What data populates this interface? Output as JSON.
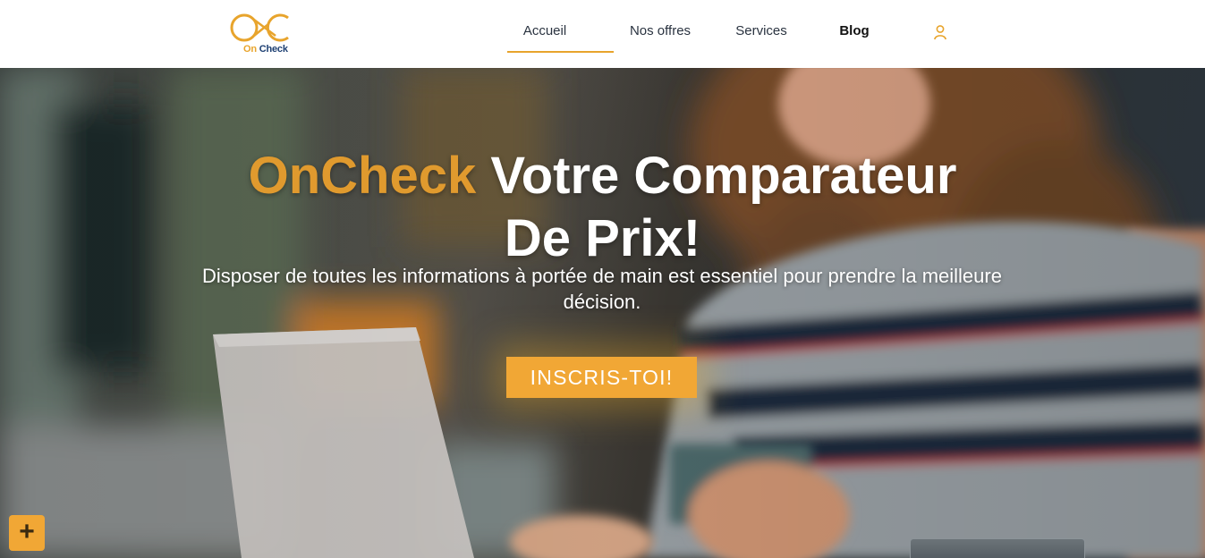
{
  "brand": {
    "logo_on": "On",
    "logo_check": "Check",
    "colors": {
      "accent": "#e8a42c",
      "dark_blue": "#1d3f72"
    }
  },
  "nav": {
    "items": [
      {
        "label": "Accueil",
        "active": true
      },
      {
        "label": "Nos offres",
        "active": false
      },
      {
        "label": "Services",
        "active": false
      },
      {
        "label": "Blog",
        "active": false
      }
    ],
    "user_icon": "user-icon"
  },
  "hero": {
    "title_brand": "OnCheck",
    "title_line1": " Votre Comparateur",
    "title_line2": "De Prix!",
    "subtitle": "Disposer de toutes les informations à portée de main est essentiel pour prendre la meilleure décision.",
    "cta_label": "INSCRIS-TOI!"
  },
  "fab": {
    "label": "+",
    "icon": "plus-icon"
  }
}
